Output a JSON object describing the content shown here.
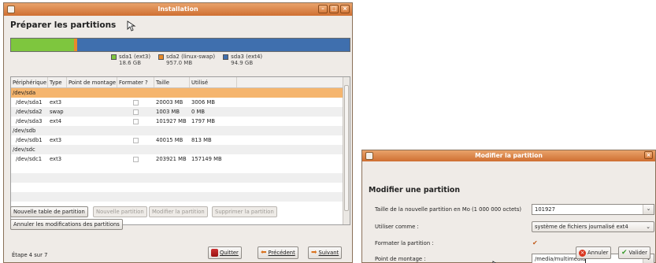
{
  "main_window": {
    "title": "Installation",
    "heading": "Préparer les partitions",
    "partition_bar": [
      {
        "label": "sda1 (ext3)",
        "size": "18.6 GB",
        "color": "#7ec63e",
        "fraction": 0.185
      },
      {
        "label": "sda2 (linux-swap)",
        "size": "957.0 MB",
        "color": "#e88a2a",
        "fraction": 0.01
      },
      {
        "label": "sda3 (ext4)",
        "size": "94.9 GB",
        "color": "#3f6fae",
        "fraction": 0.805
      }
    ],
    "table": {
      "headers": [
        "Périphérique",
        "Type",
        "Point de montage",
        "Formater ?",
        "Taille",
        "Utilisé"
      ],
      "rows": [
        {
          "device": "/dev/sda",
          "type": "",
          "mount": "",
          "format": false,
          "size": "",
          "used": "",
          "is_disk": true
        },
        {
          "device": "/dev/sda1",
          "type": "ext3",
          "mount": "",
          "format": false,
          "size": "20003 MB",
          "used": "3006 MB"
        },
        {
          "device": "/dev/sda2",
          "type": "swap",
          "mount": "",
          "format": false,
          "size": "1003 MB",
          "used": "0 MB"
        },
        {
          "device": "/dev/sda3",
          "type": "ext4",
          "mount": "",
          "format": false,
          "size": "101927 MB",
          "used": "1797 MB"
        },
        {
          "device": "/dev/sdb",
          "type": "",
          "mount": "",
          "format": false,
          "size": "",
          "used": "",
          "is_disk": true
        },
        {
          "device": "/dev/sdb1",
          "type": "ext3",
          "mount": "",
          "format": false,
          "size": "40015 MB",
          "used": "813 MB"
        },
        {
          "device": "/dev/sdc",
          "type": "",
          "mount": "",
          "format": false,
          "size": "",
          "used": "",
          "is_disk": true
        },
        {
          "device": "/dev/sdc1",
          "type": "ext3",
          "mount": "",
          "format": false,
          "size": "203921 MB",
          "used": "157149 MB"
        }
      ]
    },
    "buttons": {
      "new_table": "Nouvelle table de partition",
      "new_partition": "Nouvelle partition",
      "modify_partition": "Modifier la partition",
      "delete_partition": "Supprimer la partition",
      "revert": "Annuler les modifications des partitions",
      "quit": "Quitter",
      "back": "Précédent",
      "forward": "Suivant"
    },
    "step": "Étape 4 sur 7"
  },
  "dialog": {
    "title": "Modifier la partition",
    "heading": "Modifier une partition",
    "size_label": "Taille de la nouvelle partition en Mo (1 000 000 octets)",
    "size_value": "101927",
    "use_as_label": "Utiliser comme :",
    "use_as_value": "système de fichiers journalisé ext4",
    "format_label": "Formater la partition :",
    "format_checked": true,
    "mount_label": "Point de montage :",
    "mount_value": "/media/multimedia",
    "cancel": "Annuler",
    "ok": "Valider"
  }
}
